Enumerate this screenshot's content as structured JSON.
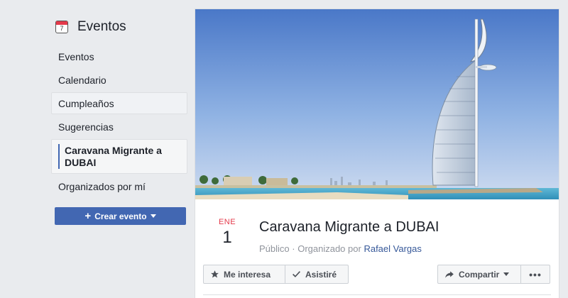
{
  "sidebar": {
    "title": "Eventos",
    "calendar_icon_day": "7",
    "items": [
      {
        "label": "Eventos"
      },
      {
        "label": "Calendario"
      },
      {
        "label": "Cumpleaños"
      },
      {
        "label": "Sugerencias"
      },
      {
        "label": "Caravana Migrante a DUBAI"
      },
      {
        "label": "Organizados por mí"
      }
    ],
    "create_button": "Crear evento"
  },
  "event": {
    "month": "ENE",
    "day": "1",
    "title": "Caravana Migrante a DUBAI",
    "privacy": "Público",
    "separator": " · ",
    "organized_by": "Organizado por",
    "organizer": "Rafael Vargas"
  },
  "actions": {
    "interested": "Me interesa",
    "going": "Asistiré",
    "share": "Compartir"
  },
  "colors": {
    "brand": "#4267b2",
    "accent_red": "#e4394a",
    "link": "#365899"
  }
}
